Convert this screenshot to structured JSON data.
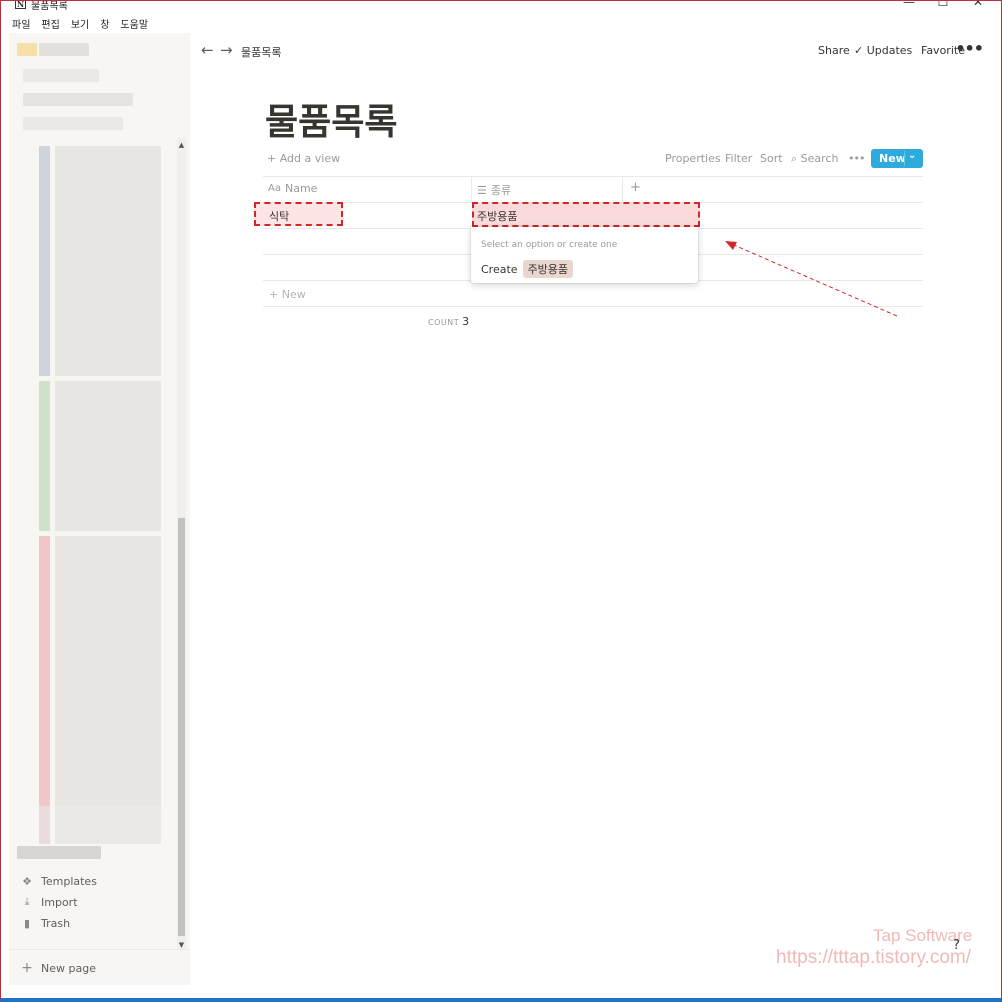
{
  "window": {
    "title": "물품목록",
    "logo": "N",
    "minimize": "—",
    "maximize": "☐",
    "close": "✕"
  },
  "menu": [
    "파일",
    "편집",
    "보기",
    "창",
    "도움말"
  ],
  "sidebar": {
    "items": [
      {
        "label": "Templates",
        "icon": "templates-icon"
      },
      {
        "label": "Import",
        "icon": "import-icon"
      },
      {
        "label": "Trash",
        "icon": "trash-icon"
      }
    ],
    "new_page": "New page"
  },
  "topbar": {
    "breadcrumb": "물품목록",
    "share": "Share",
    "updates": "Updates",
    "favorite": "Favorite",
    "more": "•••"
  },
  "page": {
    "title": "물품목록",
    "add_view": "Add a view",
    "properties": "Properties",
    "filter": "Filter",
    "sort": "Sort",
    "search": "Search",
    "more": "•••",
    "new_button": "New"
  },
  "table": {
    "columns": [
      {
        "label": "Name",
        "icon": "Aa"
      },
      {
        "label": "종류",
        "icon": "☰"
      }
    ],
    "rows": [
      {
        "name": "식탁",
        "type": "주방용품"
      },
      {
        "name": "",
        "type": ""
      },
      {
        "name": "",
        "type": ""
      }
    ],
    "new_row": "New",
    "count_label": "COUNT",
    "count_value": "3"
  },
  "dropdown": {
    "hint": "Select an option or create one",
    "create_label": "Create",
    "create_value": "주방용품"
  },
  "watermark": {
    "line1": "Tap Software",
    "line2": "https://tttap.tistory.com/"
  },
  "help": "?",
  "colors": {
    "accent": "#2eaadc",
    "highlight_border": "#d0262c",
    "sidebar_bg": "#f7f6f3",
    "chip": "#e9d7cf"
  }
}
